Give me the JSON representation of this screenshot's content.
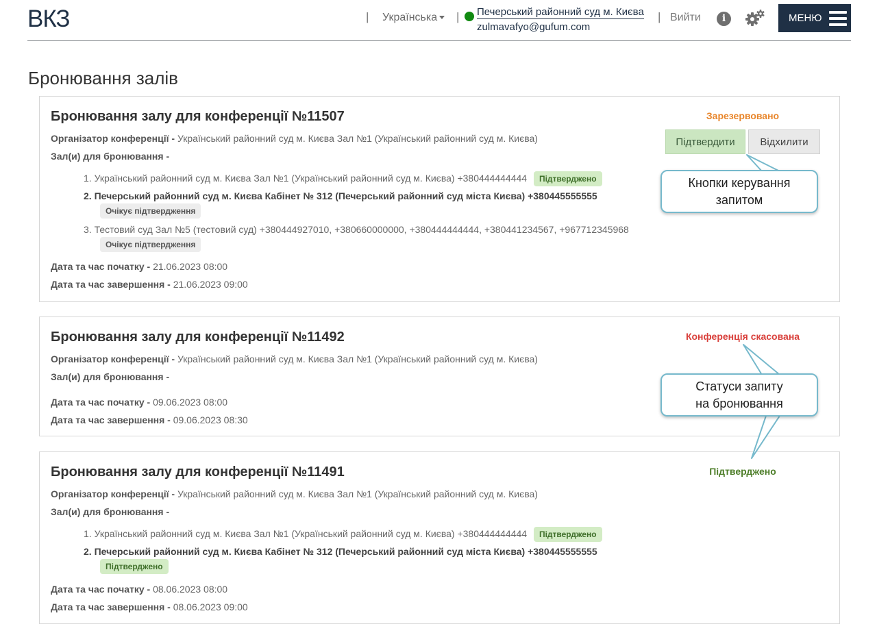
{
  "header": {
    "logo": "ВКЗ",
    "separator": "|",
    "language": "Українська",
    "court_name": "Печерський районний суд м. Києва",
    "user_email": "zulmavafyo@gufum.com",
    "logout": "Вийти",
    "menu_label": "МЕНЮ",
    "info_glyph": "i",
    "colors": {
      "brand": "#1f3045",
      "online": "#118a11"
    },
    "icons": [
      "info-icon",
      "gear-icon",
      "hamburger-icon",
      "caret-down-icon"
    ]
  },
  "page": {
    "title": "Бронювання залів"
  },
  "labels": {
    "organizer": "Організатор конференції -",
    "halls": "Зал(и) для бронювання -",
    "start": "Дата та час початку -",
    "end": "Дата та час завершення -"
  },
  "cards": [
    {
      "title": "Бронювання залу для конференції №11507",
      "status": "Зарезервовано",
      "organizer": "Український районний суд м. Києва Зал №1 (Український районний суд м. Києва)",
      "halls": [
        {
          "text": "1. Український районний суд м. Києва Зал №1 (Український районний суд м. Києва) +380444444444",
          "badge": "Підтверджено"
        },
        {
          "text": "2. Печерський районний суд м. Києва Кабінет № 312 (Печерський районний суд міста Києва) +380445555555",
          "badge": "Очікує підтвердження"
        },
        {
          "text": "3. Тестовий суд Зал №5 (тестовий суд) +380444927010, +380660000000, +380444444444, +380441234567, +967712345968",
          "badge": "Очікує підтвердження"
        }
      ],
      "start": "21.06.2023 08:00",
      "end": "21.06.2023 09:00",
      "buttons": {
        "confirm": "Підтвердити",
        "reject": "Відхилити"
      }
    },
    {
      "title": "Бронювання залу для конференції №11492",
      "status": "Конференція скасована",
      "organizer": "Український районний суд м. Києва Зал №1 (Український районний суд м. Києва)",
      "halls": [],
      "start": "09.06.2023 08:00",
      "end": "09.06.2023 08:30"
    },
    {
      "title": "Бронювання залу для конференції №11491",
      "status": "Підтверджено",
      "organizer": "Український районний суд м. Києва Зал №1 (Український районний суд м. Києва)",
      "halls": [
        {
          "text": "1. Український районний суд м. Києва Зал №1 (Український районний суд м. Києва) +380444444444",
          "badge": "Підтверджено"
        },
        {
          "text": "2. Печерський районний суд м. Києва Кабінет № 312 (Печерський районний суд міста Києва) +380445555555",
          "badge": "Підтверджено"
        }
      ],
      "start": "08.06.2023 08:00",
      "end": "08.06.2023 09:00"
    }
  ],
  "callouts": {
    "controls": {
      "line1": "Кнопки керування",
      "line2": "запитом"
    },
    "statuses": {
      "line1": "Статуси запиту",
      "line2": "на бронювання"
    }
  }
}
